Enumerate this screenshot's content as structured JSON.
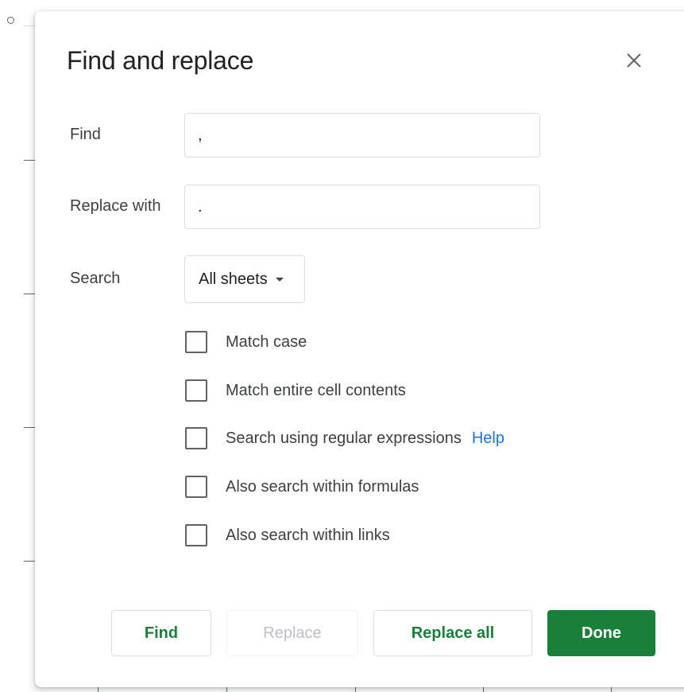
{
  "dialog": {
    "title": "Find and replace"
  },
  "find": {
    "label": "Find",
    "value": ","
  },
  "replace": {
    "label": "Replace with",
    "value": "."
  },
  "search": {
    "label": "Search",
    "selected": "All sheets"
  },
  "options": [
    {
      "label": "Match case",
      "checked": false
    },
    {
      "label": "Match entire cell contents",
      "checked": false
    },
    {
      "label": "Search using regular expressions",
      "checked": false
    },
    {
      "label": "Also search within formulas",
      "checked": false
    },
    {
      "label": "Also search within links",
      "checked": false
    }
  ],
  "help_link": "Help",
  "buttons": {
    "find": "Find",
    "replace": "Replace",
    "replace_all": "Replace all",
    "done": "Done"
  },
  "colors": {
    "accent": "#188038",
    "link": "#1a73e8",
    "disabled_text": "#bdc1c6"
  },
  "icons": {
    "close": "close-icon",
    "dropdown": "caret-down-icon"
  }
}
